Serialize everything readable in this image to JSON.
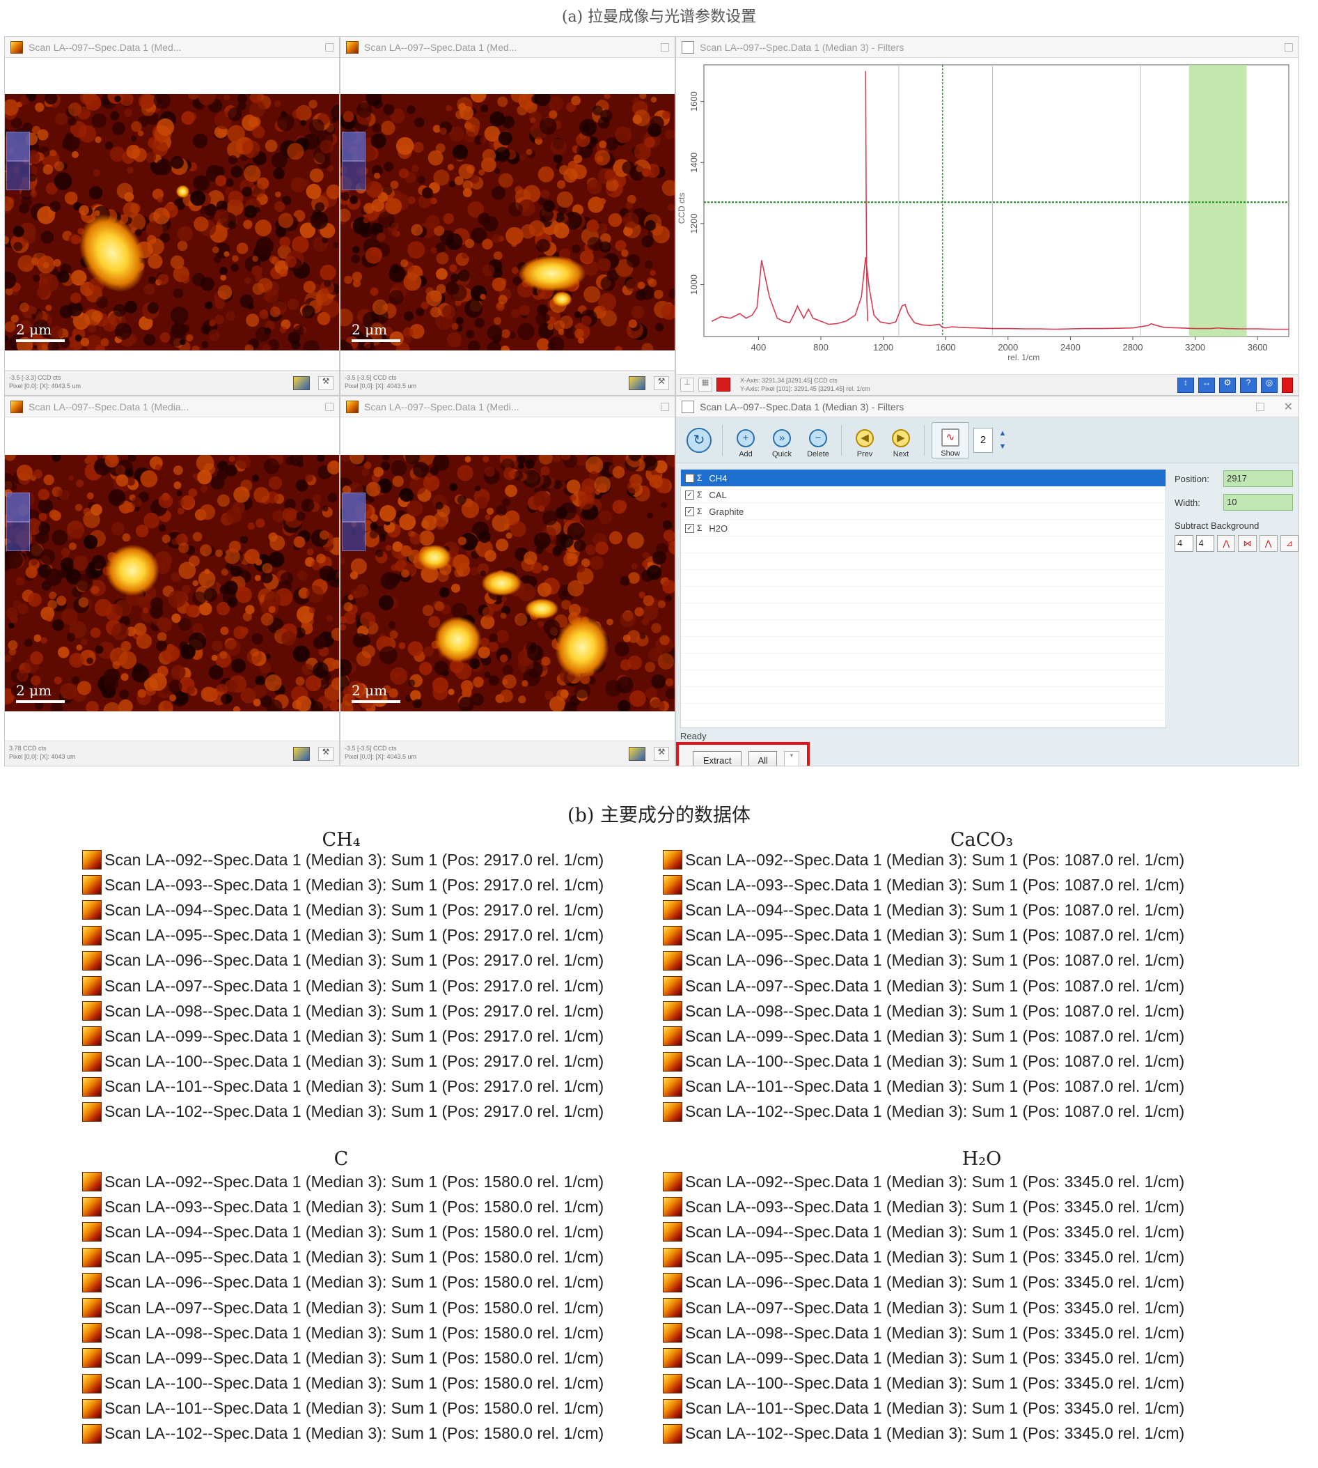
{
  "top_caption": "(a) 拉曼成像与光谱参数设置",
  "map_windows": [
    {
      "title": "Scan LA--097--Spec.Data 1 (Med...",
      "scale": "2 μm",
      "status_line1": "-3.5 [-3.3] CCD cts",
      "status_line2": "Pixel [0,0]: [X]: 4043.5 um"
    },
    {
      "title": "Scan LA--097--Spec.Data 1 (Med...",
      "scale": "2 μm",
      "status_line1": "-3.5 [-3.5] CCD cts",
      "status_line2": "Pixel [0,0]: [X]: 4043.5 um"
    },
    {
      "title": "Scan LA--097--Spec.Data 1 (Media...",
      "scale": "2 μm",
      "status_line1": "3.78 CCD cts",
      "status_line2": "Pixel [0,0]: [X]: 4043 um"
    },
    {
      "title": "Scan LA--097--Spec.Data 1 (Medi...",
      "scale": "2 μm",
      "status_line1": "-3.5 [-3.5] CCD cts",
      "status_line2": "Pixel [0,0]: [X]: 4043.5 um"
    }
  ],
  "spectrum_window": {
    "title": "Scan LA--097--Spec.Data 1 (Median 3) - Filters",
    "status_x_axis": "X-Axis: 3291.34 [3291.45] CCD cts",
    "status_y_axis": "Y-Axis: Pixel [101]: 3291.45 [3291.45] rel. 1/cm"
  },
  "chart_data": {
    "type": "line",
    "xlabel": "rel. 1/cm",
    "ylabel": "CCD cts",
    "x_ticks": [
      400,
      800,
      1200,
      1600,
      2000,
      2400,
      2800,
      3200,
      3600
    ],
    "y_ticks": [
      1000,
      1200,
      1400,
      1600
    ],
    "xlim": [
      50,
      3800
    ],
    "ylim": [
      830,
      1720
    ],
    "series": [
      {
        "x": [
          100,
          160,
          220,
          280,
          320,
          360,
          390,
          420,
          470,
          520,
          560,
          600,
          630,
          650,
          690,
          720,
          750,
          800,
          850,
          900,
          960,
          1020,
          1060,
          1087,
          1110,
          1140,
          1180,
          1240,
          1280,
          1320,
          1340,
          1360,
          1400,
          1450,
          1500,
          1560,
          1580,
          1600,
          1640,
          1700,
          1800,
          1900,
          2000,
          2100,
          2200,
          2300,
          2400,
          2500,
          2600,
          2700,
          2800,
          2900,
          2917,
          2940,
          3000,
          3100,
          3200,
          3300,
          3345,
          3400,
          3500,
          3600,
          3700,
          3800
        ],
        "y": [
          880,
          895,
          890,
          905,
          890,
          900,
          925,
          1080,
          960,
          890,
          880,
          875,
          905,
          930,
          890,
          920,
          890,
          880,
          870,
          872,
          880,
          900,
          960,
          1090,
          990,
          900,
          878,
          872,
          878,
          930,
          935,
          905,
          875,
          868,
          866,
          870,
          860,
          858,
          862,
          860,
          858,
          856,
          856,
          855,
          855,
          854,
          855,
          856,
          856,
          857,
          858,
          866,
          872,
          868,
          860,
          858,
          856,
          856,
          858,
          856,
          855,
          855,
          854,
          854
        ]
      }
    ],
    "extra_line": {
      "x": [
        1087,
        1090,
        1095,
        1100
      ],
      "y": [
        1700,
        1300,
        950,
        880
      ]
    },
    "cursor_x": 1580,
    "cursor_y": 1270,
    "highlight_band": [
      3160,
      3530
    ],
    "ref_lines": [
      1300,
      1900,
      2850
    ]
  },
  "filters_window": {
    "title": "Scan LA--097--Spec.Data 1 (Median 3) - Filters",
    "toolbar": {
      "add": "Add",
      "quick": "Quick",
      "delete": "Delete",
      "prev": "Prev",
      "next": "Next",
      "show": "Show",
      "count": "2"
    },
    "filters": [
      {
        "name": "CH4",
        "selected": true
      },
      {
        "name": "CAL",
        "selected": false
      },
      {
        "name": "Graphite",
        "selected": false
      },
      {
        "name": "H2O",
        "selected": false
      }
    ],
    "position_label": "Position:",
    "position_value": "2917",
    "width_label": "Width:",
    "width_value": "10",
    "subtract_label": "Subtract Background",
    "subtract_a": "4",
    "subtract_b": "4",
    "ready": "Ready",
    "extract": "Extract",
    "all": "All"
  },
  "section_b_title": "(b) 主要成分的数据体",
  "groups": [
    {
      "title": "CH₄",
      "pos": "2917.0",
      "items": [
        "092",
        "093",
        "094",
        "095",
        "096",
        "097",
        "098",
        "099",
        "100",
        "101",
        "102"
      ]
    },
    {
      "title": "CaCO₃",
      "pos": "1087.0",
      "items": [
        "092",
        "093",
        "094",
        "095",
        "096",
        "097",
        "098",
        "099",
        "100",
        "101",
        "102"
      ]
    },
    {
      "title": "C",
      "pos": "1580.0",
      "items": [
        "092",
        "093",
        "094",
        "095",
        "096",
        "097",
        "098",
        "099",
        "100",
        "101",
        "102"
      ]
    },
    {
      "title": "H₂O",
      "pos": "3345.0",
      "items": [
        "092",
        "093",
        "094",
        "095",
        "096",
        "097",
        "098",
        "099",
        "100",
        "101",
        "102"
      ]
    }
  ],
  "item_template": "Scan LA--{id}--Spec.Data 1 (Median 3): Sum 1 (Pos: {pos} rel. 1/cm)",
  "colors": {
    "highlight": "#e0141c",
    "band": "#b9e39d",
    "cursor": "#2aa02a",
    "spectrum": "#d63a52"
  }
}
